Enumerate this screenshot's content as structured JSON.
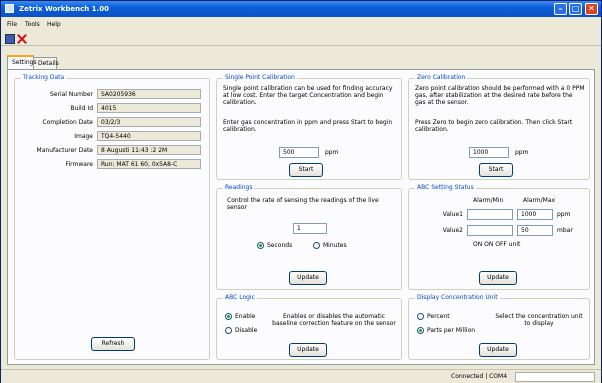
{
  "window": {
    "title": "Zetrix Workbench 1.00",
    "minimize_glyph": "–",
    "maximize_glyph": "□",
    "close_glyph": "✕"
  },
  "menu": [
    "File",
    "Tools",
    "Help"
  ],
  "toolbar": {
    "icons": [
      "save-icon",
      "stop-icon"
    ]
  },
  "tabs": {
    "active": "Settings",
    "other": "Details"
  },
  "tracking": {
    "title": "Tracking Data",
    "rows": [
      {
        "label": "Serial Number",
        "value": "SA0205936"
      },
      {
        "label": "Build Id",
        "value": "4015"
      },
      {
        "label": "Completion Date",
        "value": "03/2/3"
      },
      {
        "label": "Image",
        "value": "TQ4-5440"
      },
      {
        "label": "Manufacturer Date",
        "value": "8 Augusti 11:43 :2 2M"
      },
      {
        "label": "Firmware",
        "value": "Run: MAT 61 60, 0x5A8-C"
      }
    ],
    "button": "Refresh"
  },
  "single_point": {
    "title": "Single Point Calibration",
    "desc1": "Single point calibration can be used for finding accuracy at low cost. Enter the target Concentration and begin calibration.",
    "desc2": "Enter gas concentration in ppm and press Start to begin calibration.",
    "value": "500",
    "unit": "ppm",
    "button": "Start"
  },
  "zero_cal": {
    "title": "Zero Calibration",
    "desc1": "Zero point calibration should be performed with a 0 PPM gas, after stabilization at the desired rate before the gas at the sensor.",
    "desc2": "Press Zero to begin zero calibration. Then click Start calibration.",
    "value": "1000",
    "unit": "ppm",
    "button": "Start"
  },
  "readings": {
    "title": "Readings",
    "desc": "Control the rate of sensing the readings of the live sensor",
    "value": "1",
    "radio_a": "Seconds",
    "radio_b": "Minutes",
    "button": "Update"
  },
  "alarm": {
    "title": "ABC Setting Status",
    "col1": "Alarm/Min",
    "col2": "Alarm/Max",
    "row1_label": "Value1",
    "row1_v2": "1000",
    "row1_unit": "ppm",
    "row2_label": "Value2",
    "row2_v2": "50",
    "row2_unit": "mbar",
    "note": "ON  ON  OFF unit",
    "button": "Update"
  },
  "abc_logic": {
    "title": "ABC Logic",
    "enable": "Enable",
    "disable": "Disable",
    "desc": "Enables or disables the automatic baseline correction feature on the sensor",
    "button": "Update"
  },
  "display": {
    "title": "Display Concentration Unit",
    "opt1": "Percent",
    "opt2": "Parts per Million",
    "desc": "Select the concentration unit to display",
    "button": "Update"
  },
  "status": {
    "label": "Connected | COM4"
  }
}
